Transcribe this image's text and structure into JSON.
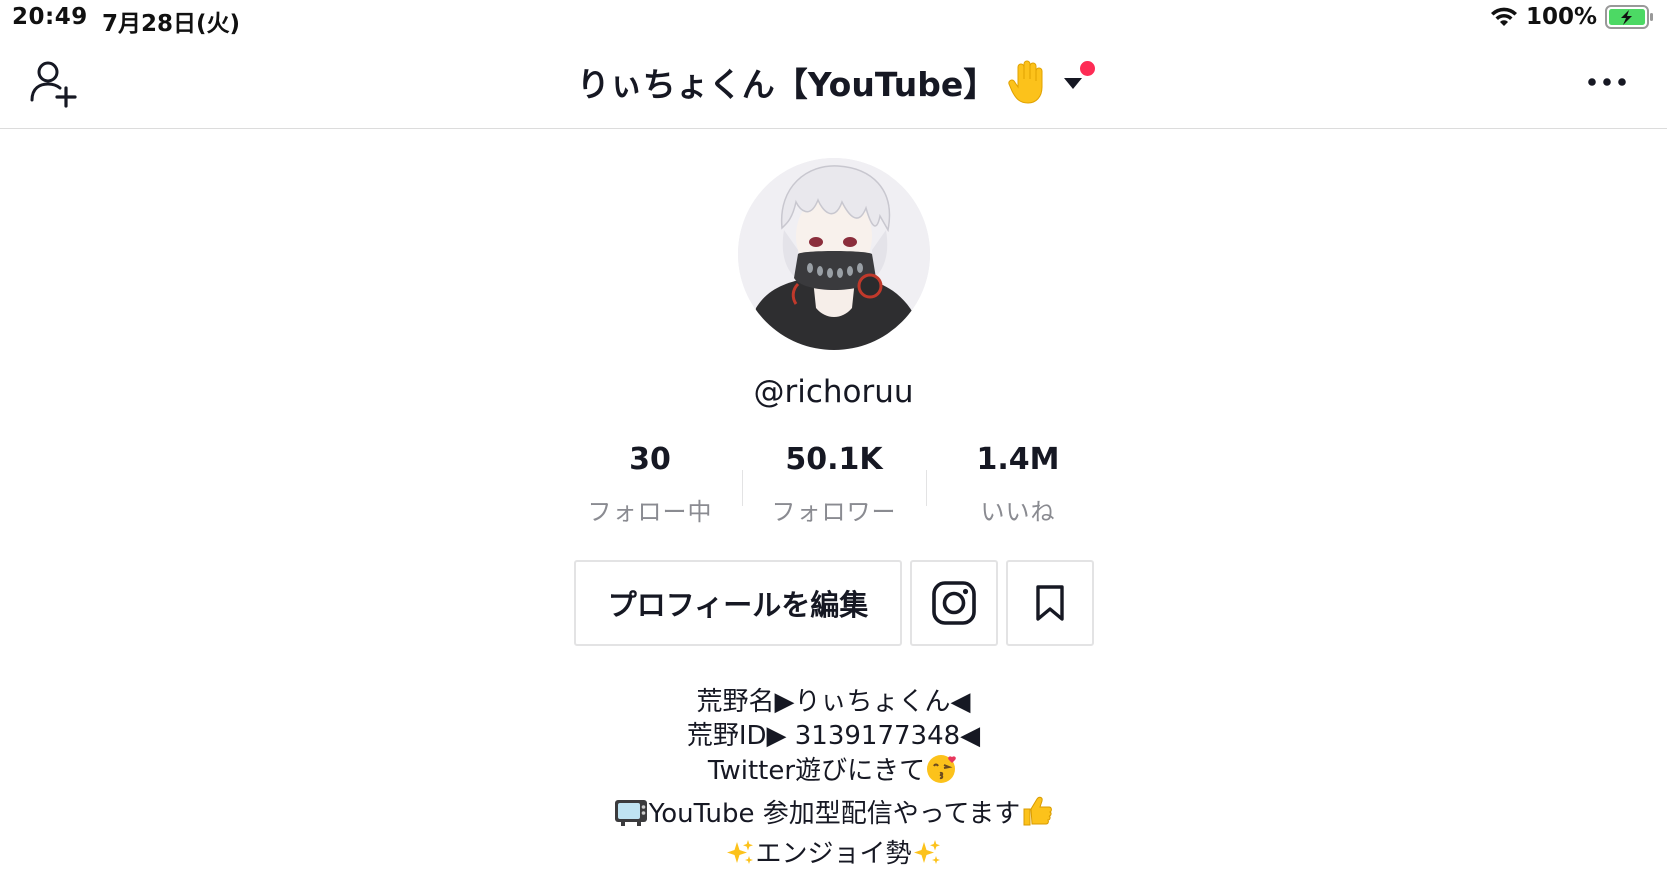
{
  "status_bar": {
    "time": "20:49",
    "date": "7月28日(火)",
    "battery": "100%"
  },
  "nav": {
    "title": "りぃちょくん【YouTube】",
    "title_emoji": "hand-icon",
    "has_notification": true
  },
  "profile": {
    "username": "@richoruu",
    "stats": [
      {
        "value": "30",
        "label": "フォロー中"
      },
      {
        "value": "50.1K",
        "label": "フォロワー"
      },
      {
        "value": "1.4M",
        "label": "いいね"
      }
    ],
    "edit_button": "プロフィールを編集"
  },
  "bio": {
    "line1": "荒野名▶りぃちょくん◀",
    "line2": "荒野ID▶ 3139177348◀",
    "line3": "Twitter遊びにきて",
    "line4": "YouTube 参加型配信やってます",
    "line5": "エンジョイ勢"
  },
  "colors": {
    "accent_dot": "#fe2c55",
    "text": "#161823",
    "secondary_text": "#8a8b91",
    "battery_green": "#4cd964"
  }
}
